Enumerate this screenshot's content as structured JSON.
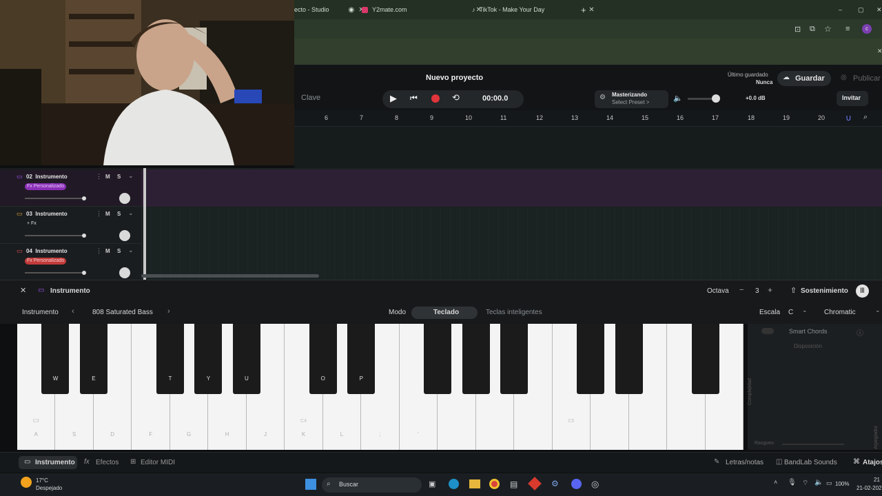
{
  "browser": {
    "tabs": [
      {
        "label": "ecto - Studio"
      },
      {
        "label": "Y2mate.com"
      },
      {
        "label": "TikTok - Make Your Day"
      }
    ],
    "new_tab": "+",
    "window_controls": [
      "–",
      "▢",
      "✕"
    ]
  },
  "header": {
    "project_title": "Nuevo proyecto",
    "key_label": "Clave",
    "time": "00:00.0",
    "mastering_title": "Masterizando",
    "mastering_preset": "Select Preset >",
    "volume_db": "+0.0 dB",
    "last_saved_label": "Último guardado",
    "last_saved_value": "Nunca",
    "save_label": "Guardar",
    "publish_label": "Publicar",
    "invite_label": "Invitar"
  },
  "ruler": {
    "ticks": [
      "6",
      "7",
      "8",
      "9",
      "10",
      "11",
      "12",
      "13",
      "14",
      "15",
      "16",
      "17",
      "18",
      "19",
      "20"
    ]
  },
  "tracks": [
    {
      "number": "02",
      "name": "Instrumento",
      "fx": "Fx Personalizado",
      "fx_color": "#8b2fb8",
      "icon_color": "#a855f7"
    },
    {
      "number": "03",
      "name": "Instrumento",
      "fx": "+ Fx",
      "fx_color": "transparent",
      "icon_color": "#e0a33a"
    },
    {
      "number": "04",
      "name": "Instrumento",
      "fx": "Fx Personalizado",
      "fx_color": "#c23a3a",
      "icon_color": "#e05050"
    }
  ],
  "track_buttons": {
    "mute": "M",
    "solo": "S"
  },
  "panel": {
    "title": "Instrumento",
    "octave_label": "Octava",
    "octave_value": "3",
    "sustain_label": "Sostenimiento",
    "instrument_label": "Instrumento",
    "preset_name": "808 Saturated Bass",
    "mode_label": "Modo",
    "mode_keyboard": "Teclado",
    "mode_smart": "Teclas inteligentes",
    "scale_label": "Escala",
    "scale_key": "C",
    "scale_type": "Chromatic",
    "smart_chords": "Smart Chords",
    "disposition": "Disposición",
    "complexity": "Complejidad",
    "strum": "Rasgueo",
    "arpeggiator": "Arpegiador"
  },
  "keyboard": {
    "white_keys": [
      "A",
      "S",
      "D",
      "F",
      "G",
      "H",
      "J",
      "K",
      "L",
      ";",
      "'",
      "",
      "",
      "",
      "",
      "",
      "",
      "",
      ""
    ],
    "white_notes": [
      "C3",
      "",
      "",
      "",
      "",
      "",
      "",
      "C4",
      "",
      "",
      "",
      "",
      "",
      "",
      "C5",
      "",
      "",
      "",
      ""
    ],
    "black_keys": [
      "W",
      "E",
      "T",
      "Y",
      "U",
      "O",
      "P",
      "",
      "",
      "",
      "",
      "",
      "",
      ""
    ]
  },
  "bottom": {
    "tab_instrument": "Instrumento",
    "tab_effects": "Efectos",
    "tab_midi": "Editor MIDI",
    "lyrics": "Letras/notas",
    "sounds": "BandLab Sounds",
    "shortcuts": "Atajos"
  },
  "taskbar": {
    "weather_temp": "17°C",
    "weather_desc": "Despejado",
    "search": "Buscar",
    "battery": "100%",
    "time": "21",
    "date": "21-02-202"
  }
}
